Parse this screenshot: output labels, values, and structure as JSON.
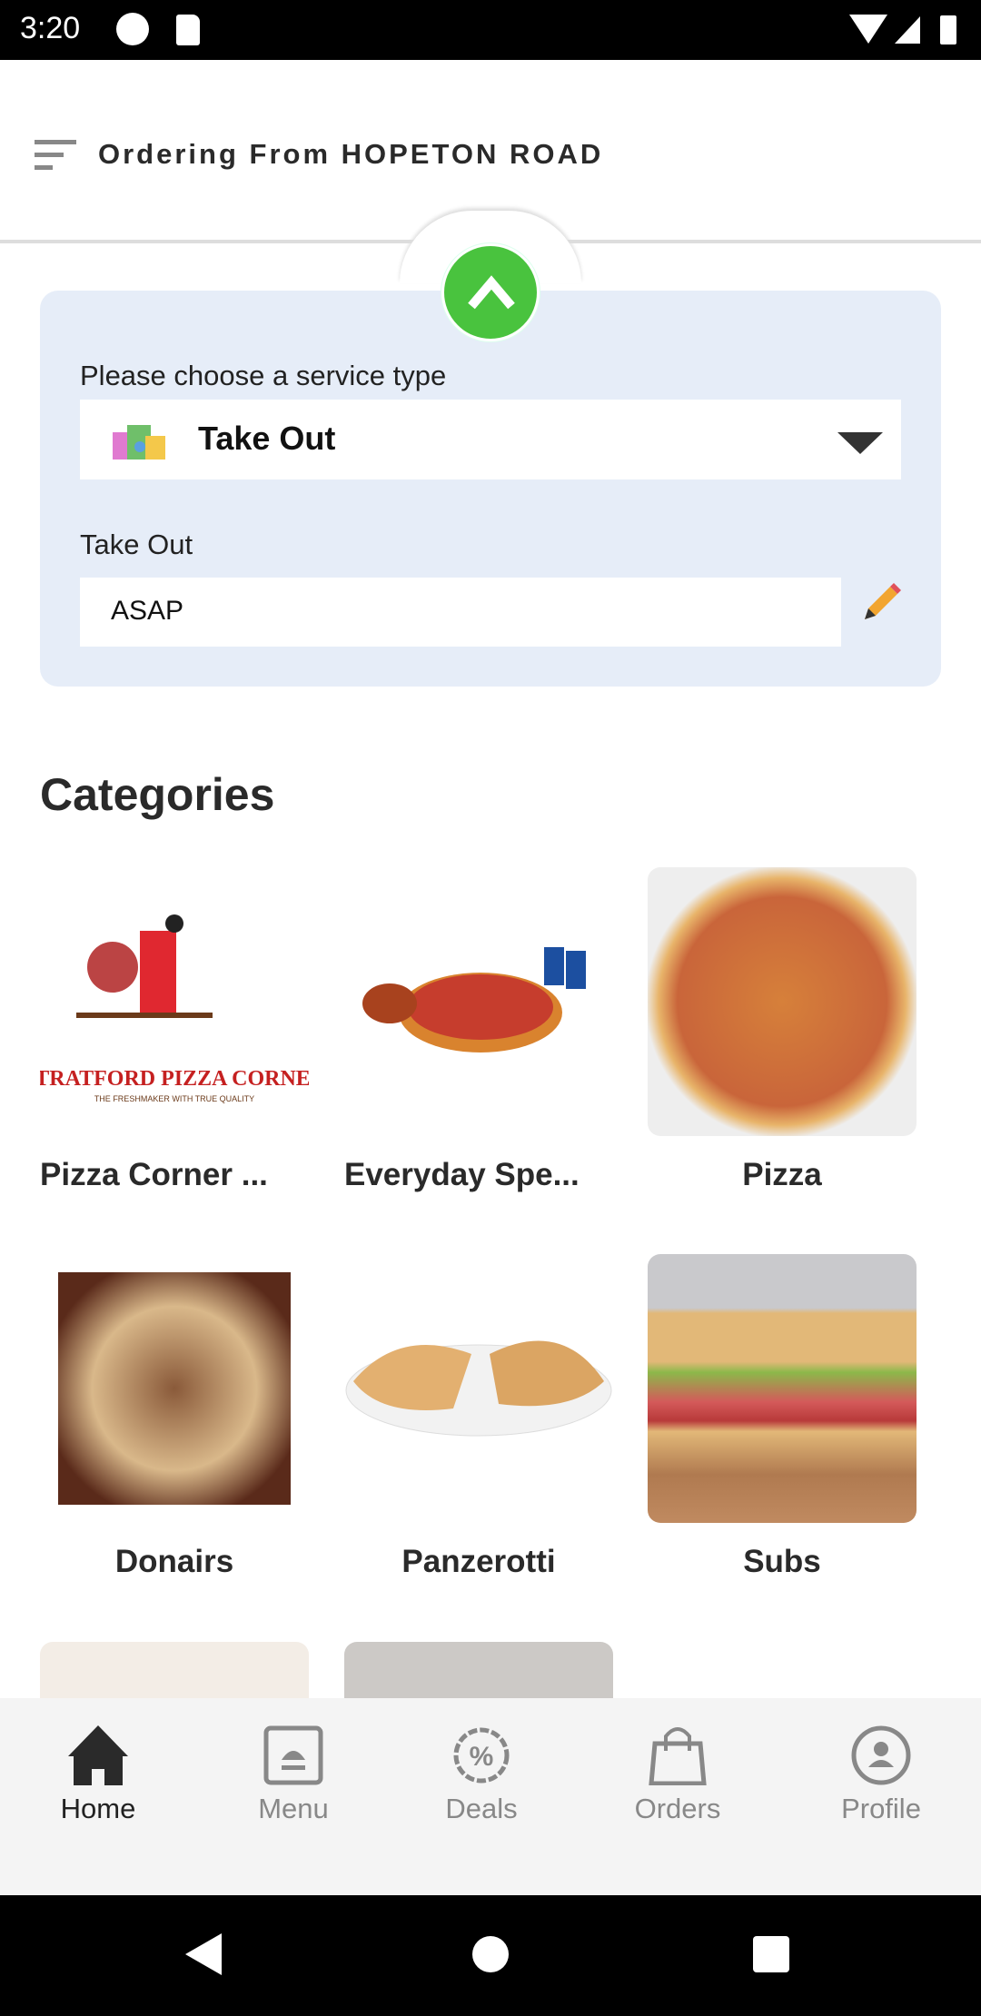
{
  "status_bar": {
    "time": "3:20"
  },
  "header": {
    "title": "Ordering From HOPETON ROAD"
  },
  "service": {
    "prompt": "Please choose a service type",
    "selected": "Take Out",
    "time_label": "Take Out",
    "time_value": "ASAP"
  },
  "categories": {
    "title": "Categories",
    "items": [
      {
        "label": "Pizza Corner ..."
      },
      {
        "label": "Everyday Spe..."
      },
      {
        "label": "Pizza"
      },
      {
        "label": "Donairs"
      },
      {
        "label": "Panzerotti"
      },
      {
        "label": "Subs"
      }
    ]
  },
  "bottom_nav": {
    "items": [
      {
        "label": "Home",
        "active": true
      },
      {
        "label": "Menu"
      },
      {
        "label": "Deals"
      },
      {
        "label": "Orders"
      },
      {
        "label": "Profile"
      }
    ]
  },
  "colors": {
    "accent_green": "#49c33e",
    "card_bg": "#e6edf8"
  }
}
